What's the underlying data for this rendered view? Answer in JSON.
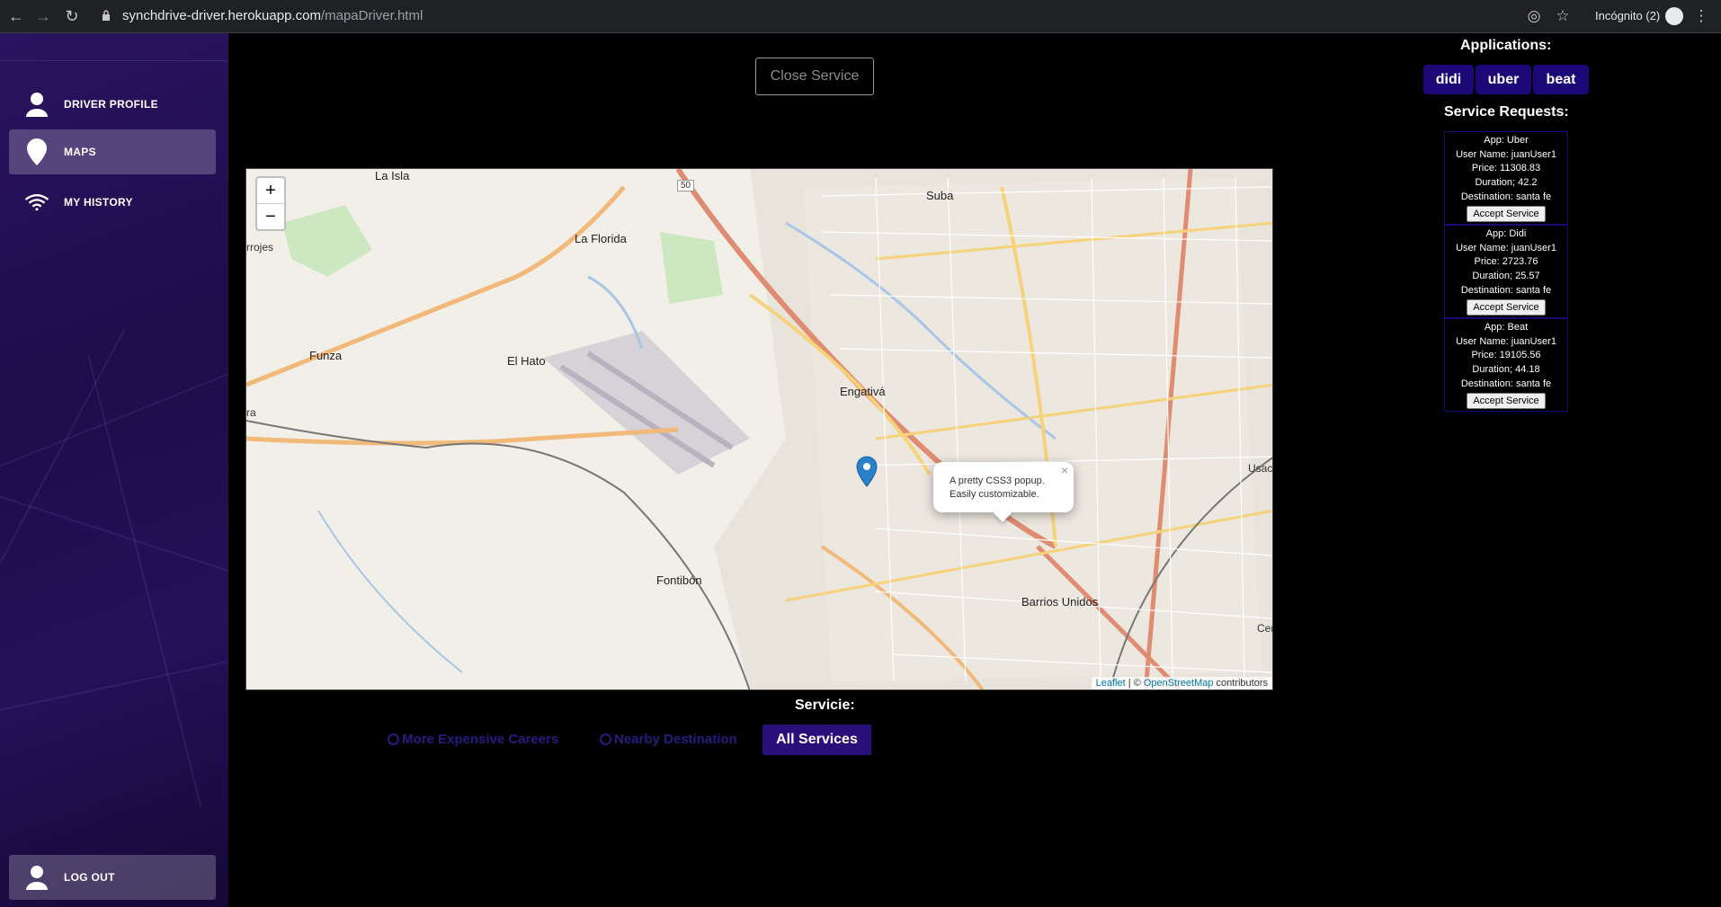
{
  "browser": {
    "url_host": "synchdrive-driver.herokuapp.com",
    "url_path": "/mapaDriver.html",
    "incognito_label": "Incógnito (2)"
  },
  "sidebar": {
    "items": [
      {
        "label": "DRIVER PROFILE",
        "icon": "user-icon"
      },
      {
        "label": "MAPS",
        "icon": "map-pin-icon",
        "active": true
      },
      {
        "label": "MY HISTORY",
        "icon": "wifi-icon"
      }
    ],
    "logout": {
      "label": "LOG OUT",
      "icon": "user-icon"
    }
  },
  "main": {
    "close_service_label": "Close Service",
    "map": {
      "zoom_in": "+",
      "zoom_out": "−",
      "popup_line1": "A pretty CSS3 popup.",
      "popup_line2": "Easily customizable.",
      "popup_close": "×",
      "attribution_leaflet": "Leaflet",
      "attribution_sep": " | © ",
      "attribution_osm": "OpenStreetMap",
      "attribution_suffix": " contributors",
      "places": [
        "La Isla",
        "La Florida",
        "Suba",
        "rrojes",
        "Funza",
        "El Hato",
        "Engativá",
        "Fontibón",
        "Barrios Unidos",
        "ra",
        "Usac",
        "Cer",
        "50"
      ]
    },
    "filter_title": "Servicie:",
    "filters": [
      {
        "label": "More Expensive Careers"
      },
      {
        "label": "Nearby Destination"
      }
    ],
    "all_services_label": "All Services"
  },
  "right_panel": {
    "applications_title": "Applications:",
    "apps": [
      "didi",
      "uber",
      "beat"
    ],
    "requests_title": "Service Requests:",
    "requests": [
      {
        "app": "App: Uber",
        "user": "User Name: juanUser1",
        "price": "Price: 11308.83",
        "duration": "Duration; 42.2",
        "destination": "Destination: santa fe",
        "accept": "Accept Service"
      },
      {
        "app": "App: Didi",
        "user": "User Name: juanUser1",
        "price": "Price: 2723.76",
        "duration": "Duration; 25.57",
        "destination": "Destination: santa fe",
        "accept": "Accept Service"
      },
      {
        "app": "App: Beat",
        "user": "User Name: juanUser1",
        "price": "Price: 19105.56",
        "duration": "Duration; 44.18",
        "destination": "Destination: santa fe",
        "accept": "Accept Service"
      }
    ]
  },
  "colors": {
    "sidebar_bg": "#1d0d4a",
    "accent": "#1d0878",
    "page_bg": "#000000"
  }
}
